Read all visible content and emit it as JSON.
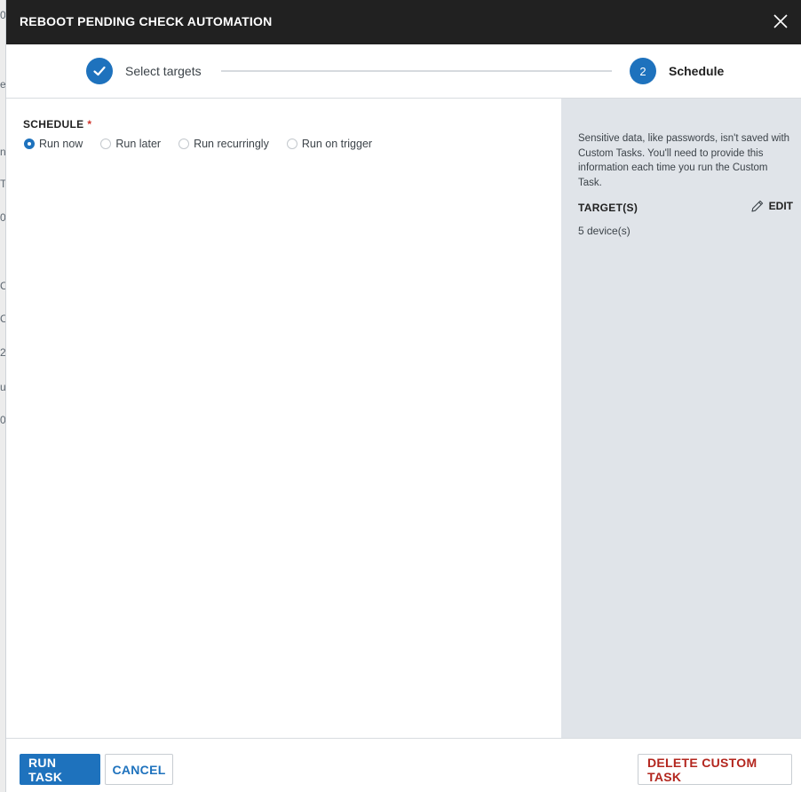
{
  "dialog": {
    "title": "REBOOT PENDING CHECK AUTOMATION"
  },
  "stepper": {
    "steps": [
      {
        "label": "Select targets",
        "status": "complete"
      },
      {
        "number": "2",
        "label": "Schedule",
        "status": "active"
      }
    ]
  },
  "schedule": {
    "label": "SCHEDULE",
    "required_marker": "*",
    "options": [
      {
        "label": "Run now",
        "selected": true
      },
      {
        "label": "Run later",
        "selected": false
      },
      {
        "label": "Run recurringly",
        "selected": false
      },
      {
        "label": "Run on trigger",
        "selected": false
      }
    ]
  },
  "sidebar": {
    "info": "Sensitive data, like passwords, isn't saved with Custom Tasks. You'll need to provide this information each time you run the Custom Task.",
    "targets_heading": "TARGET(S)",
    "edit_label": "EDIT",
    "targets_value": "5 device(s)"
  },
  "footer": {
    "run_label": "RUN TASK",
    "cancel_label": "CANCEL",
    "delete_label": "DELETE CUSTOM TASK"
  },
  "background": {
    "fragments": [
      "0",
      "e",
      "n",
      "T",
      "0",
      "C",
      "C",
      "2",
      "u",
      "0"
    ]
  },
  "colors": {
    "header_bg": "#212121",
    "accent": "#1e72bd",
    "danger": "#b3261e",
    "sidebar_bg": "#e0e4e9"
  },
  "icons": {
    "close": "close-icon",
    "check": "checkmark-icon",
    "edit": "pencil-icon"
  }
}
